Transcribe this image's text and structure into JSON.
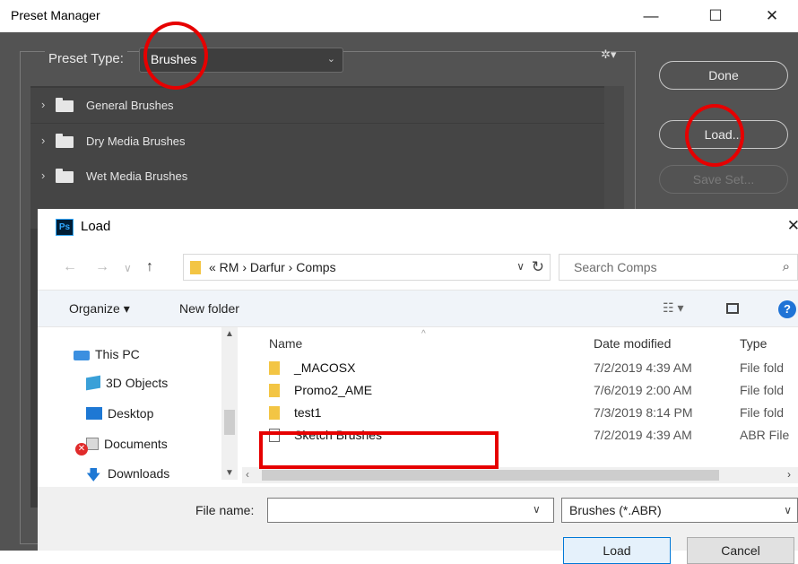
{
  "preset_manager": {
    "title": "Preset Manager",
    "preset_type_label": "Preset Type:",
    "preset_type_value": "Brushes",
    "gear_icon": "gear-icon",
    "rows": [
      {
        "label": "General Brushes"
      },
      {
        "label": "Dry Media Brushes"
      },
      {
        "label": "Wet Media Brushes"
      }
    ],
    "buttons": {
      "done": "Done",
      "load": "Load...",
      "save_set": "Save Set..."
    },
    "window_controls": {
      "minimize": "—",
      "maximize": "☐",
      "close": "✕"
    }
  },
  "load_dialog": {
    "title": "Load",
    "app_badge": "Ps",
    "close": "✕",
    "nav": {
      "back": "←",
      "forward": "→",
      "recent": "∨",
      "up": "↑"
    },
    "path": {
      "crumbs": "«  RM  ›  Darfur  ›  Comps",
      "segments": [
        "RM",
        "Darfur",
        "Comps"
      ]
    },
    "search_placeholder": "Search Comps",
    "toolbar": {
      "organize": "Organize ▾",
      "new_folder": "New folder",
      "view_menu": "☷ ▾",
      "help": "?"
    },
    "nav_pane": [
      {
        "label": "This PC",
        "icon": "computer-icon"
      },
      {
        "label": "3D Objects",
        "icon": "cube-icon"
      },
      {
        "label": "Desktop",
        "icon": "desktop-icon"
      },
      {
        "label": "Documents",
        "icon": "documents-icon"
      },
      {
        "label": "Downloads",
        "icon": "downloads-icon"
      }
    ],
    "columns": {
      "name": "Name",
      "date": "Date modified",
      "type": "Type"
    },
    "files": [
      {
        "name": "_MACOSX",
        "date": "7/2/2019 4:39 AM",
        "type": "File fold",
        "kind": "folder"
      },
      {
        "name": "Promo2_AME",
        "date": "7/6/2019 2:00 AM",
        "type": "File fold",
        "kind": "folder"
      },
      {
        "name": "test1",
        "date": "7/3/2019 8:14 PM",
        "type": "File fold",
        "kind": "folder"
      },
      {
        "name": "Sketch Brushes",
        "date": "7/2/2019 4:39 AM",
        "type": "ABR File",
        "kind": "abr"
      }
    ],
    "file_name_label": "File name:",
    "file_name_value": "",
    "file_type_value": "Brushes (*.ABR)",
    "buttons": {
      "load": "Load",
      "cancel": "Cancel"
    }
  },
  "colors": {
    "ps_dark": "#535353",
    "annotation_red": "#e60000",
    "folder_yellow": "#f3c544",
    "accent_blue": "#0078d7"
  }
}
